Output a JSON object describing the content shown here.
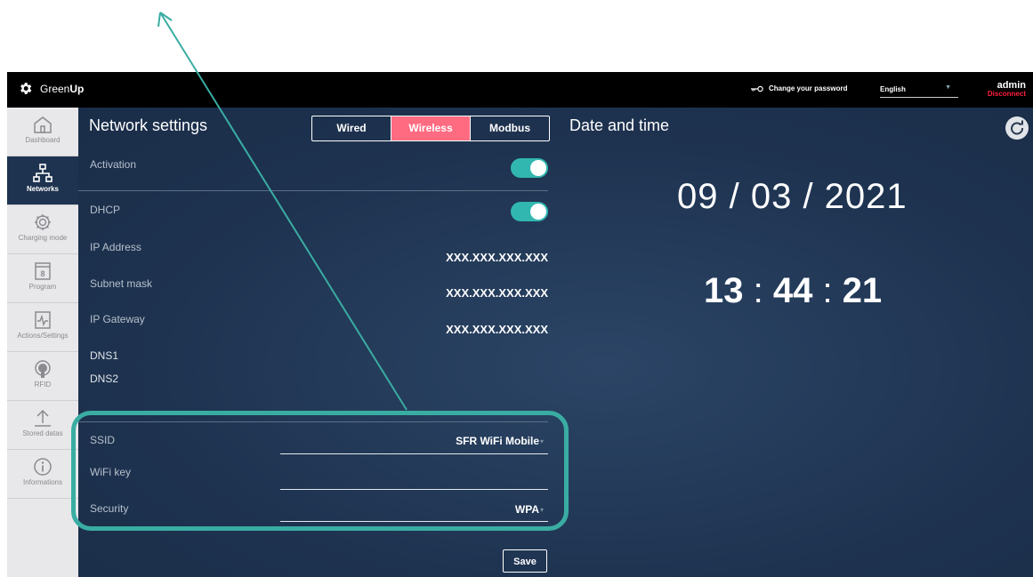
{
  "header": {
    "brand_prefix": "Green",
    "brand_bold": "Up",
    "change_password": "Change your password",
    "language": "English",
    "user": "admin",
    "disconnect": "Disconnect"
  },
  "sidebar": {
    "items": [
      {
        "label": "Dashboard",
        "icon": "home-icon"
      },
      {
        "label": "Networks",
        "icon": "network-icon",
        "active": true
      },
      {
        "label": "Charging mode",
        "icon": "gear-icon"
      },
      {
        "label": "Program",
        "icon": "calendar-icon"
      },
      {
        "label": "Actions/Settings",
        "icon": "pulse-icon"
      },
      {
        "label": "RFID",
        "icon": "rfid-icon"
      },
      {
        "label": "Stored datas",
        "icon": "upload-icon"
      },
      {
        "label": "Informations",
        "icon": "info-icon"
      }
    ]
  },
  "network": {
    "title": "Network settings",
    "tabs": [
      {
        "label": "Wired",
        "active": false
      },
      {
        "label": "Wireless",
        "active": true
      },
      {
        "label": "Modbus",
        "active": false
      }
    ],
    "activation_label": "Activation",
    "activation_on": true,
    "dhcp_label": "DHCP",
    "dhcp_on": true,
    "ip_label": "IP Address",
    "ip_value": "XXX.XXX.XXX.XXX",
    "subnet_label": "Subnet mask",
    "subnet_value": "XXX.XXX.XXX.XXX",
    "gateway_label": "IP Gateway",
    "gateway_value": "XXX.XXX.XXX.XXX",
    "dns1_label": "DNS1",
    "dns2_label": "DNS2",
    "ssid_label": "SSID",
    "ssid_value": "SFR WiFi Mobile",
    "wifikey_label": "WiFi key",
    "wifikey_value": "",
    "security_label": "Security",
    "security_value": "WPA",
    "save_label": "Save"
  },
  "datetime": {
    "title": "Date and time",
    "date": "09 / 03 / 2021",
    "hours": "13",
    "minutes": "44",
    "seconds": "21"
  },
  "colors": {
    "accent": "#ff6b81",
    "toggle": "#31b7b0",
    "annotation": "#3aada3",
    "background": "#1e3350",
    "disconnect": "#ff1e3c"
  }
}
